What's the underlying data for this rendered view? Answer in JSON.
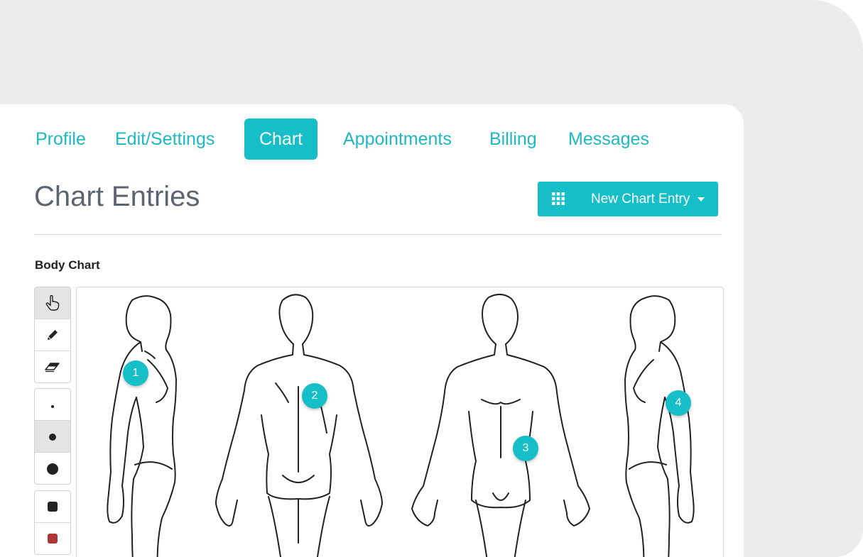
{
  "nav": {
    "tabs": [
      {
        "label": "Profile"
      },
      {
        "label": "Edit/Settings"
      },
      {
        "label": "Chart",
        "active": true
      },
      {
        "label": "Appointments"
      },
      {
        "label": "Billing"
      },
      {
        "label": "Messages"
      }
    ]
  },
  "page": {
    "title": "Chart Entries",
    "new_entry_button": {
      "label": "New Chart Entry",
      "icon": "grid-icon"
    }
  },
  "body_chart": {
    "label": "Body Chart",
    "tools": [
      "pointer-hand-icon",
      "pencil-icon",
      "eraser-icon"
    ],
    "sizes": [
      "small",
      "medium",
      "large"
    ],
    "colors": [
      "#222222",
      "#b03535"
    ],
    "markers": [
      {
        "number": "1"
      },
      {
        "number": "2"
      },
      {
        "number": "3"
      },
      {
        "number": "4"
      }
    ]
  },
  "colors": {
    "accent": "#16bec8",
    "title": "#5b6470"
  }
}
